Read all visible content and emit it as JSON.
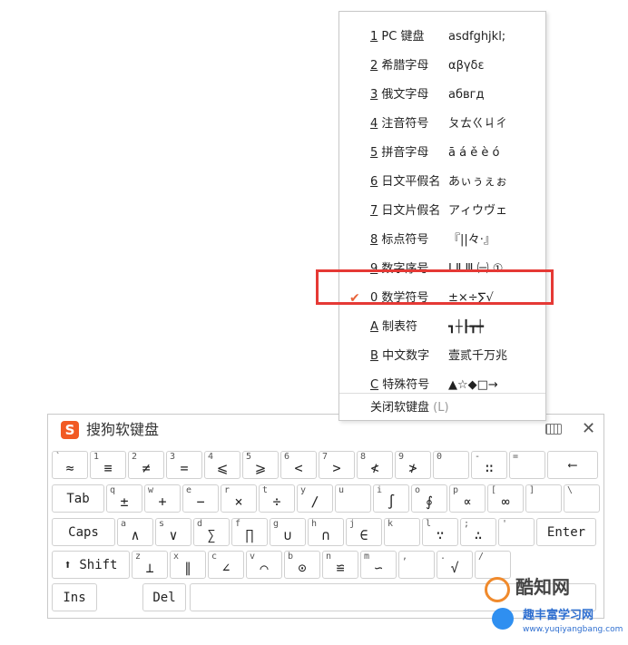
{
  "keyboard": {
    "title": "搜狗软键盘",
    "logo": "S",
    "close": "✕",
    "rows": [
      [
        {
          "s": "`",
          "y": "≈"
        },
        {
          "s": "1",
          "y": "≡"
        },
        {
          "s": "2",
          "y": "≠"
        },
        {
          "s": "3",
          "y": "="
        },
        {
          "s": "4",
          "y": "⩽"
        },
        {
          "s": "5",
          "y": "⩾"
        },
        {
          "s": "6",
          "y": "<"
        },
        {
          "s": "7",
          "y": ">"
        },
        {
          "s": "8",
          "y": "≮"
        },
        {
          "s": "9",
          "y": "≯"
        },
        {
          "s": "0",
          "y": ""
        },
        {
          "s": "-",
          "y": "∷"
        },
        {
          "s": "=",
          "y": ""
        },
        {
          "l": "⟵"
        }
      ],
      [
        {
          "l": "Tab"
        },
        {
          "s": "q",
          "y": "±"
        },
        {
          "s": "w",
          "y": "+"
        },
        {
          "s": "e",
          "y": "−"
        },
        {
          "s": "r",
          "y": "×"
        },
        {
          "s": "t",
          "y": "÷"
        },
        {
          "s": "y",
          "y": "∕"
        },
        {
          "s": "u",
          "y": ""
        },
        {
          "s": "i",
          "y": "∫"
        },
        {
          "s": "o",
          "y": "∮"
        },
        {
          "s": "p",
          "y": "∝"
        },
        {
          "s": "[",
          "y": "∞"
        },
        {
          "s": "]",
          "y": ""
        },
        {
          "s": "\\",
          "y": ""
        }
      ],
      [
        {
          "l": "Caps"
        },
        {
          "s": "a",
          "y": "∧"
        },
        {
          "s": "s",
          "y": "∨"
        },
        {
          "s": "d",
          "y": "∑"
        },
        {
          "s": "f",
          "y": "∏"
        },
        {
          "s": "g",
          "y": "∪"
        },
        {
          "s": "h",
          "y": "∩"
        },
        {
          "s": "j",
          "y": "∈"
        },
        {
          "s": "k",
          "y": ""
        },
        {
          "s": "l",
          "y": "∵"
        },
        {
          "s": ";",
          "y": "∴"
        },
        {
          "s": "'",
          "y": ""
        },
        {
          "l": "Enter"
        }
      ],
      [
        {
          "l": "⬆ Shift"
        },
        {
          "s": "z",
          "y": "⊥"
        },
        {
          "s": "x",
          "y": "∥"
        },
        {
          "s": "c",
          "y": "∠"
        },
        {
          "s": "v",
          "y": "⌒"
        },
        {
          "s": "b",
          "y": "⊙"
        },
        {
          "s": "n",
          "y": "≌"
        },
        {
          "s": "m",
          "y": "∽"
        },
        {
          "s": ",",
          "y": ""
        },
        {
          "s": ".",
          "y": "√"
        },
        {
          "s": "/",
          "y": ""
        }
      ],
      [
        {
          "l": "Ins"
        },
        {
          "l": "Del"
        },
        {
          "l": ""
        }
      ]
    ]
  },
  "menu": {
    "items": [
      {
        "key": "1",
        "name": "PC 键盘",
        "sample": "asdfghjkl;",
        "checked": false
      },
      {
        "key": "2",
        "name": "希腊字母",
        "sample": "αβγδε",
        "checked": false
      },
      {
        "key": "3",
        "name": "俄文字母",
        "sample": "абвгд",
        "checked": false
      },
      {
        "key": "4",
        "name": "注音符号",
        "sample": "ㄆㄊㄍㄐㄔ",
        "checked": false
      },
      {
        "key": "5",
        "name": "拼音字母",
        "sample": "ā á ě è ó",
        "checked": false
      },
      {
        "key": "6",
        "name": "日文平假名",
        "sample": "あぃぅぇぉ",
        "checked": false
      },
      {
        "key": "7",
        "name": "日文片假名",
        "sample": "アィウヴェ",
        "checked": false
      },
      {
        "key": "8",
        "name": "标点符号",
        "sample": "『||々·』",
        "checked": false
      },
      {
        "key": "9",
        "name": "数字序号",
        "sample": "Ⅰ Ⅱ Ⅲ ㈠ ①",
        "checked": false
      },
      {
        "key": "0",
        "name": "数学符号",
        "sample": "±×÷∑√",
        "checked": true
      },
      {
        "key": "A",
        "name": "制表符",
        "sample": "┓┼┠┳┿",
        "checked": false
      },
      {
        "key": "B",
        "name": "中文数字",
        "sample": "壹贰千万兆",
        "checked": false
      },
      {
        "key": "C",
        "name": "特殊符号",
        "sample": "▲☆◆□→",
        "checked": false
      }
    ],
    "close_label": "关闭软键盘",
    "close_shortcut": "(L)",
    "check_mark": "✔",
    "highlight_color": "#e53935"
  },
  "watermark": {
    "brand": "酷知网",
    "site": "趣丰富学习网",
    "url": "www.yuqiyangbang.com"
  }
}
